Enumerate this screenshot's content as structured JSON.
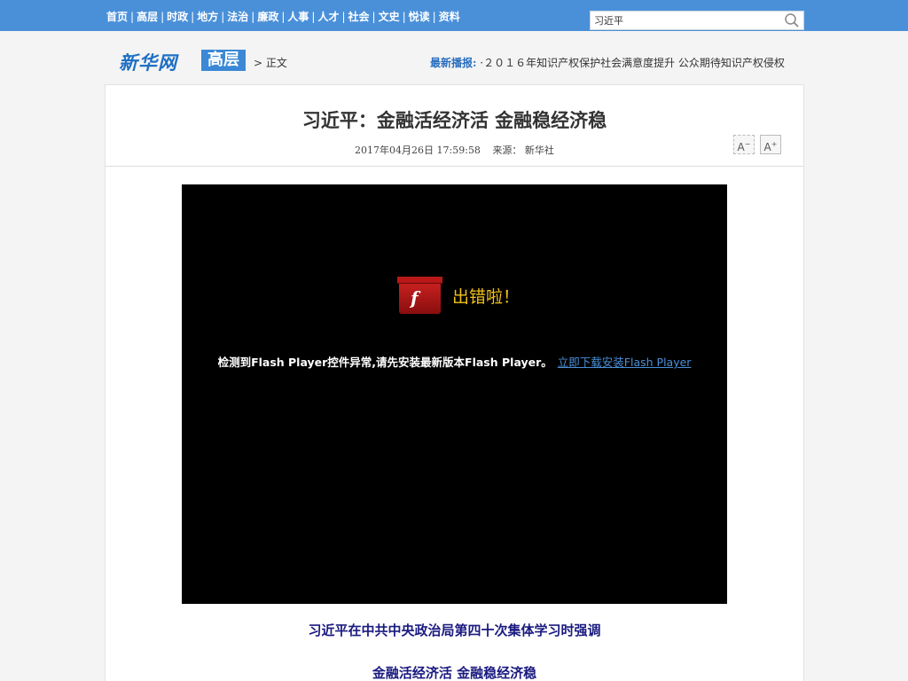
{
  "nav": {
    "items": [
      "首页",
      "高层",
      "时政",
      "地方",
      "法治",
      "廉政",
      "人事",
      "人才",
      "社会",
      "文史",
      "悦读",
      "资料"
    ],
    "separator": "|"
  },
  "search": {
    "value": "习近平",
    "icon": "search-icon"
  },
  "header": {
    "logo": "新华网",
    "channel": "高层",
    "breadcrumb": "> 正文",
    "ticker_label": "最新播报:",
    "ticker_text": "·２０１６年知识产权保护社会满意度提升 公众期待知识产权侵权"
  },
  "article": {
    "title": "习近平：金融活经济活 金融稳经济稳",
    "datetime": "2017年04月26日 17:59:58",
    "source": "来源：  新华社",
    "font_decrease": "A",
    "font_increase": "A",
    "player": {
      "icon": "flash-player-icon",
      "error_title": "出错啦！",
      "error_message": "检测到Flash Player控件异常,请先安装最新版本Flash Player。",
      "download_link": "立即下载安装Flash Player"
    },
    "paragraphs": [
      "习近平在中共中央政治局第四十次集体学习时强调",
      "金融活经济活 金融稳经济稳"
    ]
  },
  "colors": {
    "topbar": "#4a90d9",
    "link": "#4a90d9",
    "headline": "#333333",
    "error_title": "#f2c21a",
    "para": "#1a1a80"
  }
}
